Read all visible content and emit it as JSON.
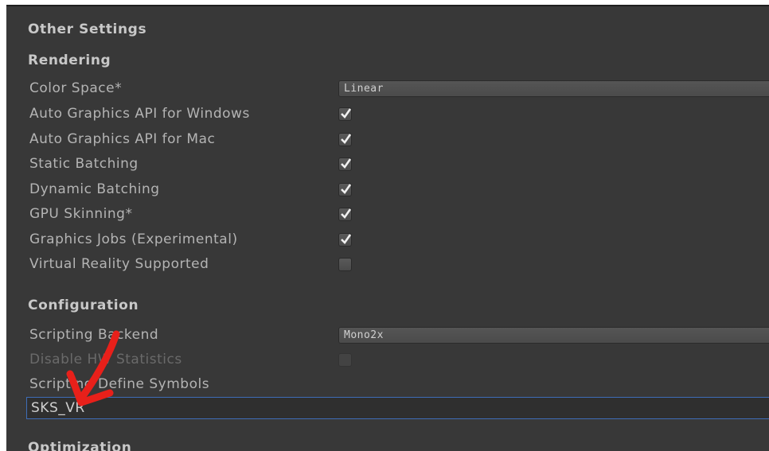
{
  "sections": {
    "other_settings": "Other Settings",
    "rendering": "Rendering",
    "configuration": "Configuration",
    "optimization": "Optimization"
  },
  "rendering": {
    "color_space_label": "Color Space*",
    "color_space_value": "Linear",
    "auto_api_windows_label": "Auto Graphics API for Windows",
    "auto_api_windows_checked": true,
    "auto_api_mac_label": "Auto Graphics API for Mac",
    "auto_api_mac_checked": true,
    "static_batching_label": "Static Batching",
    "static_batching_checked": true,
    "dynamic_batching_label": "Dynamic Batching",
    "dynamic_batching_checked": true,
    "gpu_skinning_label": "GPU Skinning*",
    "gpu_skinning_checked": true,
    "graphics_jobs_label": "Graphics Jobs (Experimental)",
    "graphics_jobs_checked": true,
    "vr_supported_label": "Virtual Reality Supported",
    "vr_supported_checked": false
  },
  "configuration": {
    "scripting_backend_label": "Scripting Backend",
    "scripting_backend_value": "Mono2x",
    "disable_hw_stats_label": "Disable HW Statistics",
    "disable_hw_stats_checked": false,
    "define_symbols_label": "Scripting Define Symbols",
    "define_symbols_value": "SKS_VR"
  },
  "annotation": {
    "arrow_color": "#e8201a"
  },
  "colors": {
    "panel_bg": "#383838",
    "focus_border": "#3e6db7"
  }
}
